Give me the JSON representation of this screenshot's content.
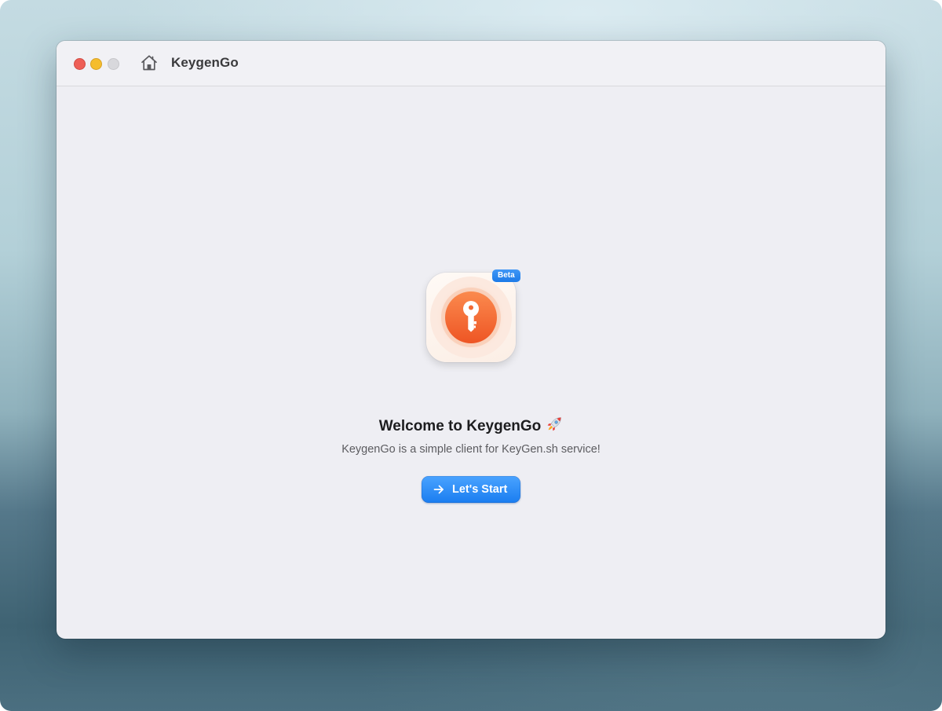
{
  "window": {
    "title": "KeygenGo"
  },
  "titlebar": {
    "controls": [
      "close",
      "minimize",
      "maximize"
    ],
    "home_icon": "house-icon"
  },
  "welcome": {
    "badge": "Beta",
    "heading": "Welcome to KeygenGo",
    "heading_emoji_icon": "rocket-icon",
    "subtitle": "KeygenGo is a simple client for KeyGen.sh service!",
    "button_label": "Let's Start",
    "button_icon": "arrow-right-icon"
  },
  "colors": {
    "accent": "#1a7df0",
    "icon_orange": "#f4602b",
    "close": "#ee5f57",
    "minimize": "#f5bd2e",
    "maximize": "#d8d8dc"
  }
}
